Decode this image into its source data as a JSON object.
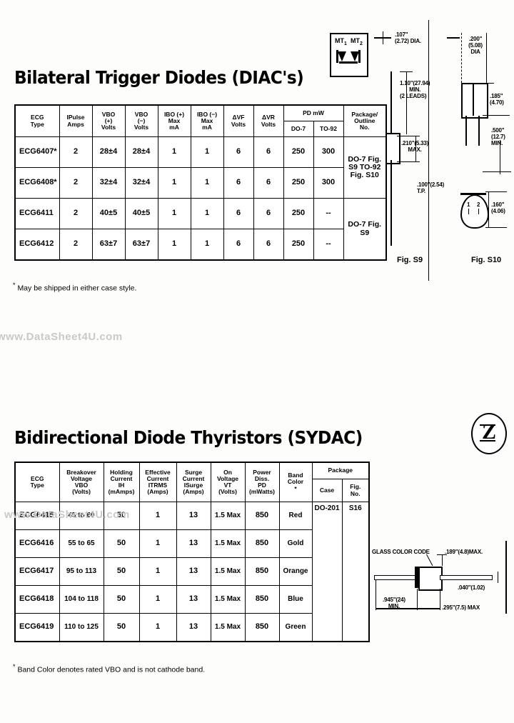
{
  "sections": {
    "diac": {
      "title": "Bilateral Trigger Diodes (DIAC's)",
      "footnote": "May be shipped in either case style.",
      "headers": {
        "ecg_type_l1": "ECG",
        "ecg_type_l2": "Type",
        "ipulse_l1": "IPulse",
        "ipulse_l2": "Amps",
        "vbo_pos_l1": "VBO",
        "vbo_pos_l2": "(+)",
        "vbo_pos_l3": "Volts",
        "vbo_neg_l1": "VBO",
        "vbo_neg_l2": "(−)",
        "vbo_neg_l3": "Volts",
        "ibo_pos_l1": "IBO (+)",
        "ibo_pos_l2": "Max",
        "ibo_pos_l3": "mA",
        "ibo_neg_l1": "IBO (−)",
        "ibo_neg_l2": "Max",
        "ibo_neg_l3": "mA",
        "dvf_l1": "ΔVF",
        "dvf_l2": "Volts",
        "dvr_l1": "ΔVR",
        "dvr_l2": "Volts",
        "pd_group": "PD mW",
        "pd_do7": "DO-7",
        "pd_to92": "TO-92",
        "package_l1": "Package/",
        "package_l2": "Outline",
        "package_l3": "No."
      },
      "rows": [
        {
          "type": "ECG6407*",
          "ipulse": "2",
          "vbo_pos": "28±4",
          "vbo_neg": "28±4",
          "ibo_pos": "1",
          "ibo_neg": "1",
          "dvf": "6",
          "dvr": "6",
          "pd_do7": "250",
          "pd_to92": "300"
        },
        {
          "type": "ECG6408*",
          "ipulse": "2",
          "vbo_pos": "32±4",
          "vbo_neg": "32±4",
          "ibo_pos": "1",
          "ibo_neg": "1",
          "dvf": "6",
          "dvr": "6",
          "pd_do7": "250",
          "pd_to92": "300"
        },
        {
          "type": "ECG6411",
          "ipulse": "2",
          "vbo_pos": "40±5",
          "vbo_neg": "40±5",
          "ibo_pos": "1",
          "ibo_neg": "1",
          "dvf": "6",
          "dvr": "6",
          "pd_do7": "250",
          "pd_to92": "--"
        },
        {
          "type": "ECG6412",
          "ipulse": "2",
          "vbo_pos": "63±7",
          "vbo_neg": "63±7",
          "ibo_pos": "1",
          "ibo_neg": "1",
          "dvf": "6",
          "dvr": "6",
          "pd_do7": "250",
          "pd_to92": "--"
        }
      ],
      "package_top_l1": "DO-7",
      "package_top_l2": "Fig. S9",
      "package_top_l3": "TO-92",
      "package_top_l4": "Fig. S10",
      "package_bot_l1": "DO-7",
      "package_bot_l2": "Fig. S9"
    },
    "sydac": {
      "title": "Bidirectional Diode Thyristors (SYDAC)",
      "footnote": "Band Color denotes rated VBO and is not cathode band.",
      "headers": {
        "ecg_type_l1": "ECG",
        "ecg_type_l2": "Type",
        "vbo_l1": "Breakover",
        "vbo_l2": "Voltage",
        "vbo_l3": "VBO",
        "vbo_l4": "(Volts)",
        "ih_l1": "Holding",
        "ih_l2": "Current",
        "ih_l3": "IH",
        "ih_l4": "(mAmps)",
        "itrms_l1": "Effective",
        "itrms_l2": "Current",
        "itrms_l3": "ITRMS",
        "itrms_l4": "(Amps)",
        "isurge_l1": "Surge",
        "isurge_l2": "Current",
        "isurge_l3": "ISurge",
        "isurge_l4": "(Amps)",
        "vt_l1": "On",
        "vt_l2": "Voltage",
        "vt_l3": "VT",
        "vt_l4": "(Volts)",
        "pd_l1": "Power",
        "pd_l2": "Diss.",
        "pd_l3": "PD",
        "pd_l4": "(mWatts)",
        "band_l1": "Band",
        "band_l2": "Color",
        "band_l3": "*",
        "package_group": "Package",
        "case": "Case",
        "fig_l1": "Fig.",
        "fig_l2": "No."
      },
      "rows": [
        {
          "type": "ECG6415",
          "vbo": "45 to  60",
          "ih": "50",
          "itrms": "1",
          "isurge": "13",
          "vt": "1.5 Max",
          "pd": "850",
          "band": "Red"
        },
        {
          "type": "ECG6416",
          "vbo": "55 to  65",
          "ih": "50",
          "itrms": "1",
          "isurge": "13",
          "vt": "1.5 Max",
          "pd": "850",
          "band": "Gold"
        },
        {
          "type": "ECG6417",
          "vbo": "95 to 113",
          "ih": "50",
          "itrms": "1",
          "isurge": "13",
          "vt": "1.5 Max",
          "pd": "850",
          "band": "Orange"
        },
        {
          "type": "ECG6418",
          "vbo": "104 to 118",
          "ih": "50",
          "itrms": "1",
          "isurge": "13",
          "vt": "1.5 Max",
          "pd": "850",
          "band": "Blue"
        },
        {
          "type": "ECG6419",
          "vbo": "110 to 125",
          "ih": "50",
          "itrms": "1",
          "isurge": "13",
          "vt": "1.5 Max",
          "pd": "850",
          "band": "Green"
        }
      ],
      "case_value": "DO-201",
      "fig_value": "S16"
    }
  },
  "drawings": {
    "symbol": {
      "mt1": "MT",
      "mt1_sub": "1",
      "mt2": "MT",
      "mt2_sub": "2"
    },
    "fig_s9": {
      "label": "Fig. S9",
      "dim_dia_l1": ".107\"",
      "dim_dia_l2": "(2.72) DIA.",
      "dim_lead_l1": "1.10\"(27.94)",
      "dim_lead_l2": "MIN.",
      "dim_lead_l3": "(2 LEADS)",
      "dim_body_l1": ".210\"(5.33)",
      "dim_body_l2": "MAX.",
      "dim_tp_l1": ".100\"(2.54)",
      "dim_tp_l2": "T.P."
    },
    "fig_s10": {
      "label": "Fig. S10",
      "dim_dia_l1": ".200\"",
      "dim_dia_l2": "(5.08)",
      "dim_dia_l3": "DIA",
      "dim_h_l1": ".185\"",
      "dim_h_l2": "(4.70)",
      "dim_lead_l1": ".500\"",
      "dim_lead_l2": "(12.7)",
      "dim_lead_l3": "MIN.",
      "dim_w_l1": ".160\"",
      "dim_w_l2": "(4.06)",
      "pin1": "1",
      "pin2": "2"
    },
    "fig_s16": {
      "color_code": "GLASS COLOR CODE",
      "dim_dia": ".189\"(4.8)MAX.",
      "dim_lead": ".040\"(1.02)",
      "dim_len_l1": ".945\"(24)",
      "dim_len_l2": "MIN.",
      "dim_body": ".295\"(7.5) MAX"
    }
  },
  "logo": {
    "letter": "Z"
  },
  "watermark": {
    "text1": "www.DataSheet4U.com",
    "text2": "www.DataSheet4U.com"
  }
}
